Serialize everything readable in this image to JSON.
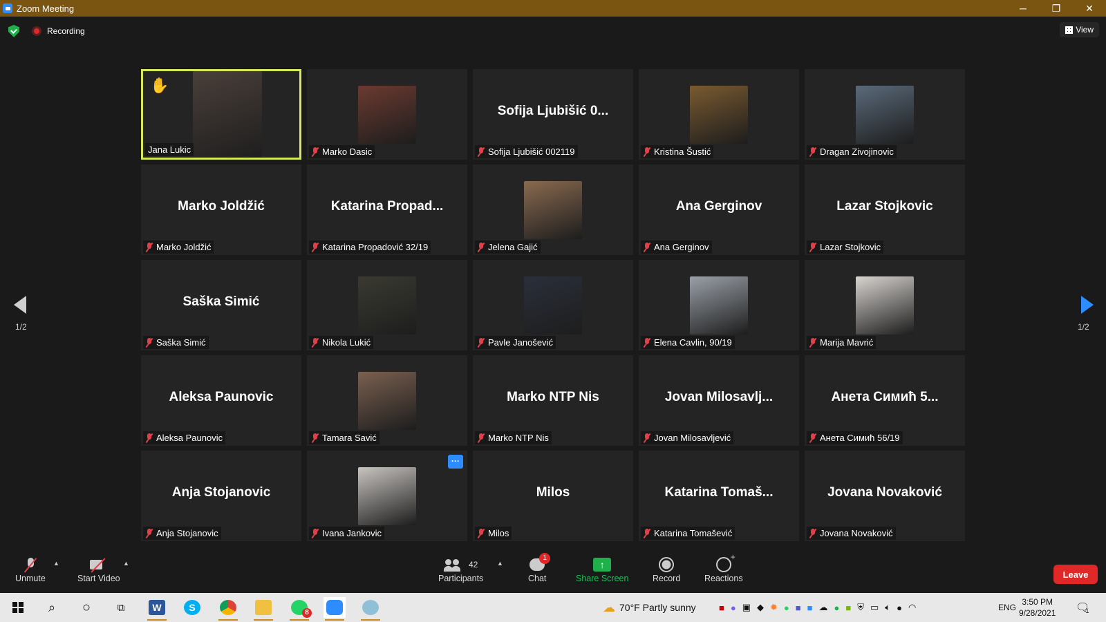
{
  "window": {
    "title": "Zoom Meeting",
    "minimize": "─",
    "restore": "❐",
    "close": "✕"
  },
  "topbar": {
    "recording_label": "Recording",
    "view_label": "View"
  },
  "tiles": [
    {
      "name": "Jana Lukic",
      "big": "",
      "photo": "#4a3f3a",
      "active": true,
      "hand": true,
      "muted": false
    },
    {
      "name": "Marko Dasic",
      "big": "",
      "photo": "#6b3a30",
      "muted": true
    },
    {
      "name": "Sofija Ljubišić 002119",
      "big": "Sofija  Ljubišić  0...",
      "muted": true
    },
    {
      "name": "Kristina Šustić",
      "big": "",
      "photo": "#7a5a30",
      "muted": true
    },
    {
      "name": "Dragan Zivojinovic",
      "big": "",
      "photo": "#5a6a7a",
      "muted": true
    },
    {
      "name": "Marko Joldžić",
      "big": "Marko Joldžić",
      "muted": true
    },
    {
      "name": "Katarina Propadović 32/19",
      "big": "Katarina  Propad...",
      "muted": true
    },
    {
      "name": "Jelena Gajić",
      "big": "",
      "photo": "#8a6a50",
      "muted": true
    },
    {
      "name": "Ana Gerginov",
      "big": "Ana Gerginov",
      "muted": true
    },
    {
      "name": "Lazar Stojkovic",
      "big": "Lazar Stojkovic",
      "muted": true
    },
    {
      "name": "Saška Simić",
      "big": "Saška Simić",
      "muted": true
    },
    {
      "name": "Nikola Lukić",
      "big": "",
      "photo": "#3a3a32",
      "muted": true
    },
    {
      "name": "Pavle Janošević",
      "big": "",
      "photo": "#2a2f3a",
      "muted": true
    },
    {
      "name": "Elena Cavlin, 90/19",
      "big": "",
      "photo": "#9aa0a8",
      "muted": true
    },
    {
      "name": "Marija Mavrić",
      "big": "",
      "photo": "#d8d4d0",
      "muted": true
    },
    {
      "name": "Aleksa Paunovic",
      "big": "Aleksa Paunovic",
      "muted": true
    },
    {
      "name": "Tamara Savić",
      "big": "",
      "photo": "#7a6050",
      "muted": true
    },
    {
      "name": "Marko NTP Nis",
      "big": "Marko NTP Nis",
      "muted": true
    },
    {
      "name": "Jovan Milosavljević",
      "big": "Jovan  Milosavlj...",
      "muted": true
    },
    {
      "name": "Анета Симић 56/19",
      "big": "Анета  Симић  5...",
      "muted": true
    },
    {
      "name": "Anja Stojanovic",
      "big": "Anja Stojanovic",
      "muted": true
    },
    {
      "name": "Ivana Jankovic",
      "big": "",
      "photo": "#c8c4c0",
      "muted": true,
      "more": true
    },
    {
      "name": "Milos",
      "big": "Milos",
      "muted": true
    },
    {
      "name": "Katarina Tomašević",
      "big": "Katarina  Tomaš...",
      "muted": true
    },
    {
      "name": "Jovana Novaković",
      "big": "Jovana Novaković",
      "muted": true
    }
  ],
  "paging": {
    "left": "1/2",
    "right": "1/2"
  },
  "controls": {
    "unmute": "Unmute",
    "start_video": "Start Video",
    "participants": "Participants",
    "participants_count": "42",
    "chat": "Chat",
    "chat_badge": "1",
    "share": "Share Screen",
    "record": "Record",
    "reactions": "Reactions",
    "leave": "Leave"
  },
  "taskbar": {
    "weather": "70°F  Partly sunny",
    "lang": "ENG",
    "time": "3:50 PM",
    "date": "9/28/2021",
    "whatsapp_badge": "8",
    "notif_badge": "1"
  },
  "colors": {
    "accent": "#2d8cff",
    "active_border": "#d7e85a",
    "leave": "#e02828",
    "share": "#20b04b"
  }
}
